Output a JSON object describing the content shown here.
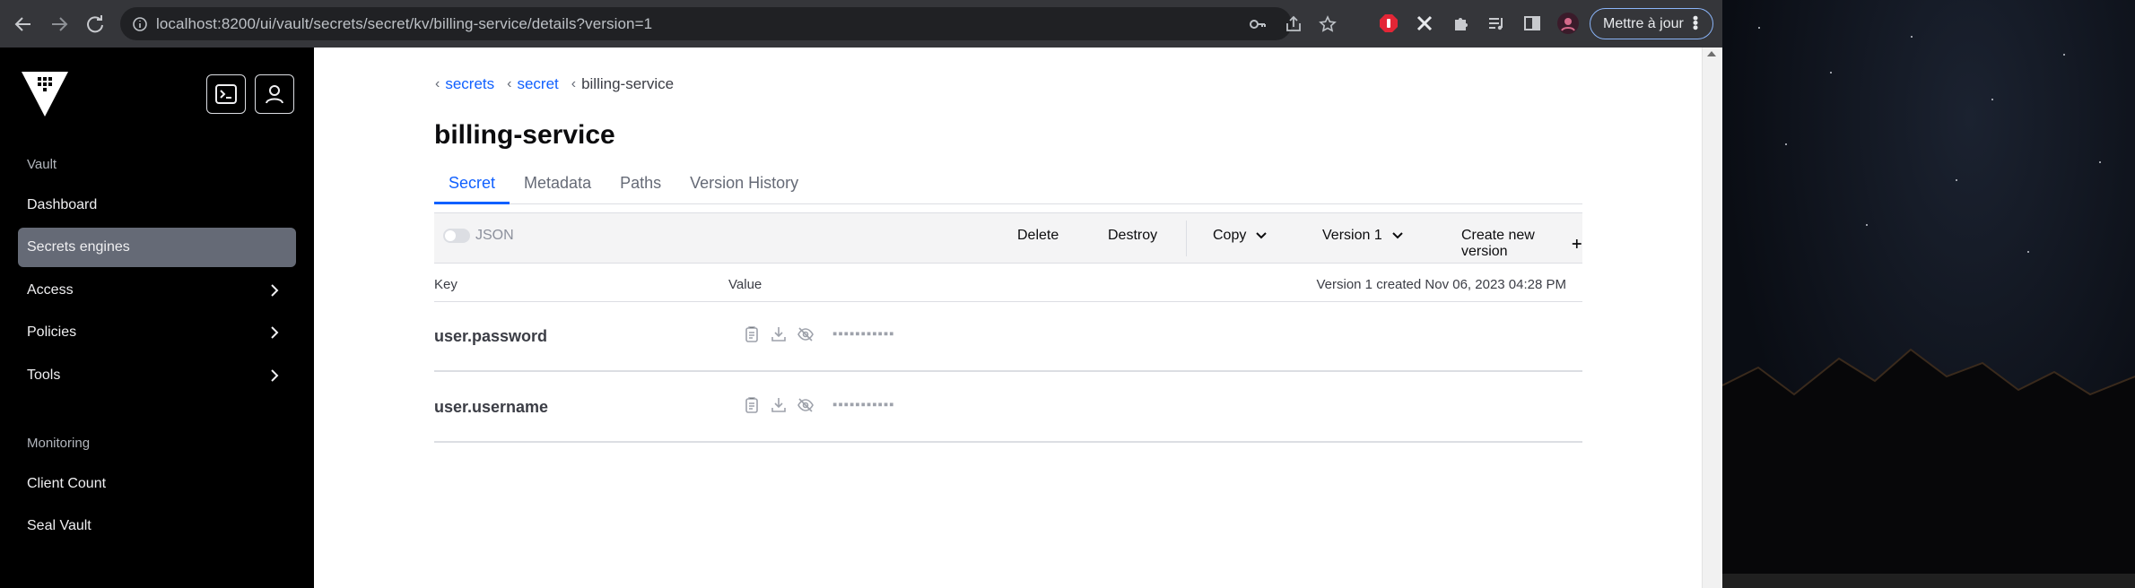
{
  "browser": {
    "url": "localhost:8200/ui/vault/secrets/secret/kv/billing-service/details?version=1",
    "update_button": "Mettre à jour"
  },
  "sidebar": {
    "section_vault": "Vault",
    "items_vault": [
      {
        "label": "Dashboard"
      },
      {
        "label": "Secrets engines"
      },
      {
        "label": "Access"
      },
      {
        "label": "Policies"
      },
      {
        "label": "Tools"
      }
    ],
    "section_monitoring": "Monitoring",
    "items_monitoring": [
      {
        "label": "Client Count"
      },
      {
        "label": "Seal Vault"
      }
    ]
  },
  "breadcrumb": {
    "items": [
      {
        "label": "secrets"
      },
      {
        "label": "secret"
      },
      {
        "label": "billing-service"
      }
    ]
  },
  "page": {
    "title": "billing-service"
  },
  "tabs": [
    {
      "label": "Secret"
    },
    {
      "label": "Metadata"
    },
    {
      "label": "Paths"
    },
    {
      "label": "Version History"
    }
  ],
  "toolbar": {
    "json_label": "JSON",
    "delete_label": "Delete",
    "destroy_label": "Destroy",
    "copy_label": "Copy",
    "version_label": "Version 1",
    "create_label": "Create new version"
  },
  "table": {
    "key_header": "Key",
    "value_header": "Value",
    "meta": "Version 1 created Nov 06, 2023 04:28 PM",
    "rows": [
      {
        "key": "user.password",
        "masked": "▪▪▪▪▪▪▪▪▪▪▪"
      },
      {
        "key": "user.username",
        "masked": "▪▪▪▪▪▪▪▪▪▪▪"
      }
    ]
  },
  "colors": {
    "accent": "#1060ff",
    "sidebar_bg": "#000000",
    "sidebar_active": "#656a76",
    "chrome_bg": "#35363a"
  }
}
